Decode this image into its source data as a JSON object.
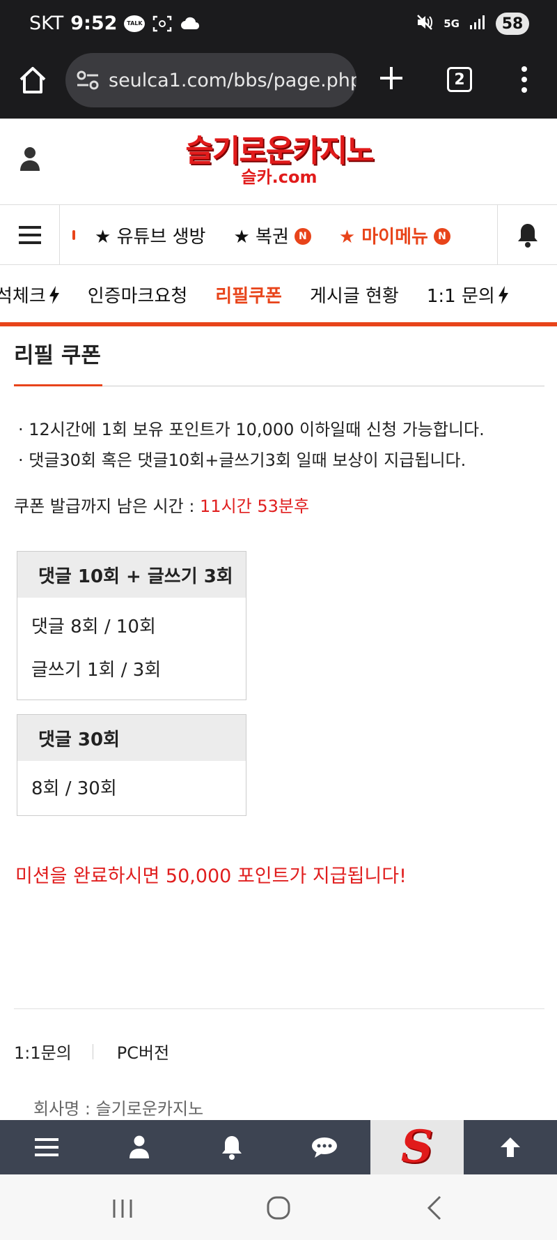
{
  "status_bar": {
    "carrier": "SKT",
    "time": "9:52",
    "talk_label": "TALK",
    "network": "5G",
    "battery": "58"
  },
  "browser": {
    "url": "seulca1.com/bbs/page.php?",
    "tab_count": "2"
  },
  "site": {
    "logo_main": "슬기로운카지노",
    "logo_sub": "슬카.com"
  },
  "nav": {
    "items": [
      {
        "label": "★ 유튜브 생방"
      },
      {
        "label": "★ 복권",
        "badge": "N"
      },
      {
        "label": "★ 마이메뉴",
        "badge": "N"
      }
    ]
  },
  "sub_nav": {
    "items": [
      {
        "label": "석체크"
      },
      {
        "label": "인증마크요청"
      },
      {
        "label": "리필쿠폰"
      },
      {
        "label": "게시글 현황"
      },
      {
        "label": "1:1 문의"
      }
    ]
  },
  "page": {
    "title": "리필 쿠폰",
    "notice_1": "· 12시간에 1회 보유 포인트가 10,000 이하일때 신청 가능합니다.",
    "notice_2": "· 댓글30회 혹은 댓글10회+글쓰기3회 일때 보상이 지급됩니다.",
    "remaining_label": "쿠폰 발급까지 남은 시간 : ",
    "remaining_value": "11시간 53분후",
    "mission_1": {
      "title": "댓글 10회 + 글쓰기 3회",
      "rows": [
        "댓글 8회 / 10회",
        "글쓰기 1회 / 3회"
      ],
      "progress": {
        "comments": {
          "done": 8,
          "goal": 10
        },
        "posts": {
          "done": 1,
          "goal": 3
        }
      }
    },
    "mission_2": {
      "title": "댓글 30회",
      "rows": [
        "8회 / 30회"
      ],
      "progress": {
        "comments": {
          "done": 8,
          "goal": 30
        }
      }
    },
    "reward": "미션을 완료하시면 50,000 포인트가 지급됩니다!"
  },
  "footer": {
    "link_inquiry": "1:1문의",
    "link_pc": "PC버전",
    "company": "회사명 : 슬기로운카지노"
  },
  "bottom_bar": {
    "logo_letter": "S"
  },
  "colors": {
    "accent": "#e8441a",
    "red_text": "#e01e1e",
    "dark_bar": "#1b1b1d",
    "bottom_bar": "#3d4452"
  }
}
